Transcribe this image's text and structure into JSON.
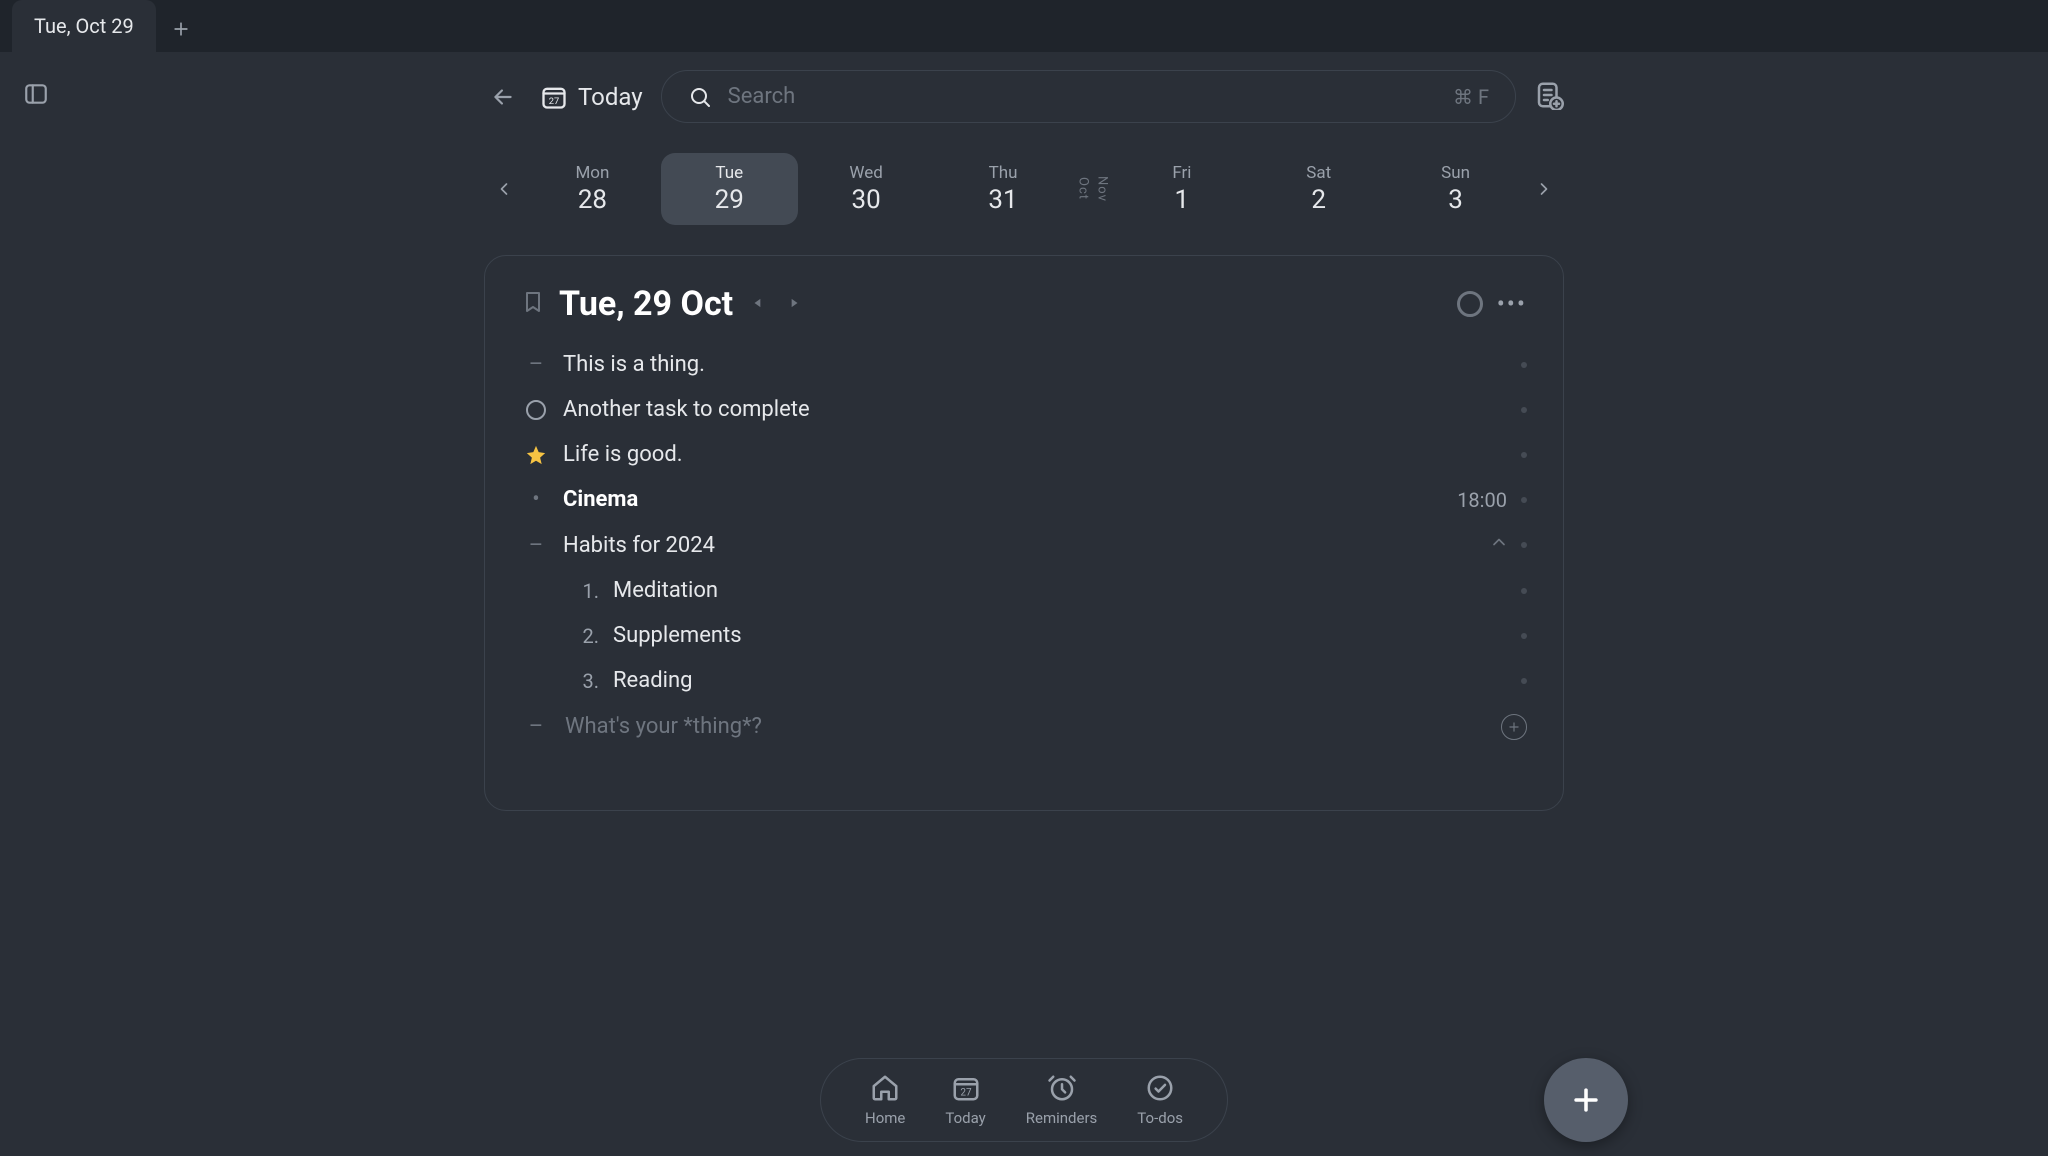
{
  "tabs": {
    "active": "Tue, Oct 29"
  },
  "toolbar": {
    "today_label": "Today",
    "today_icon_num": "27",
    "search_placeholder": "Search",
    "search_shortcut": "⌘ F"
  },
  "dateStrip": {
    "monthLeft": "Oct",
    "monthRight": "Nov",
    "days": [
      {
        "dow": "Mon",
        "num": "28",
        "active": false
      },
      {
        "dow": "Tue",
        "num": "29",
        "active": true
      },
      {
        "dow": "Wed",
        "num": "30",
        "active": false
      },
      {
        "dow": "Thu",
        "num": "31",
        "active": false
      },
      {
        "dow": "Fri",
        "num": "1",
        "active": false
      },
      {
        "dow": "Sat",
        "num": "2",
        "active": false
      },
      {
        "dow": "Sun",
        "num": "3",
        "active": false
      }
    ]
  },
  "page": {
    "title": "Tue, 29 Oct",
    "entries": {
      "note1": "This is a thing.",
      "task1": "Another task to complete",
      "star1": "Life is good.",
      "event1": {
        "text": "Cinema",
        "time": "18:00"
      },
      "group1": "Habits for 2024",
      "habits": [
        "Meditation",
        "Supplements",
        "Reading"
      ],
      "new_placeholder": "What's your *thing*?"
    }
  },
  "dock": {
    "home": "Home",
    "today": "Today",
    "today_icon_num": "27",
    "reminders": "Reminders",
    "todos": "To-dos"
  }
}
